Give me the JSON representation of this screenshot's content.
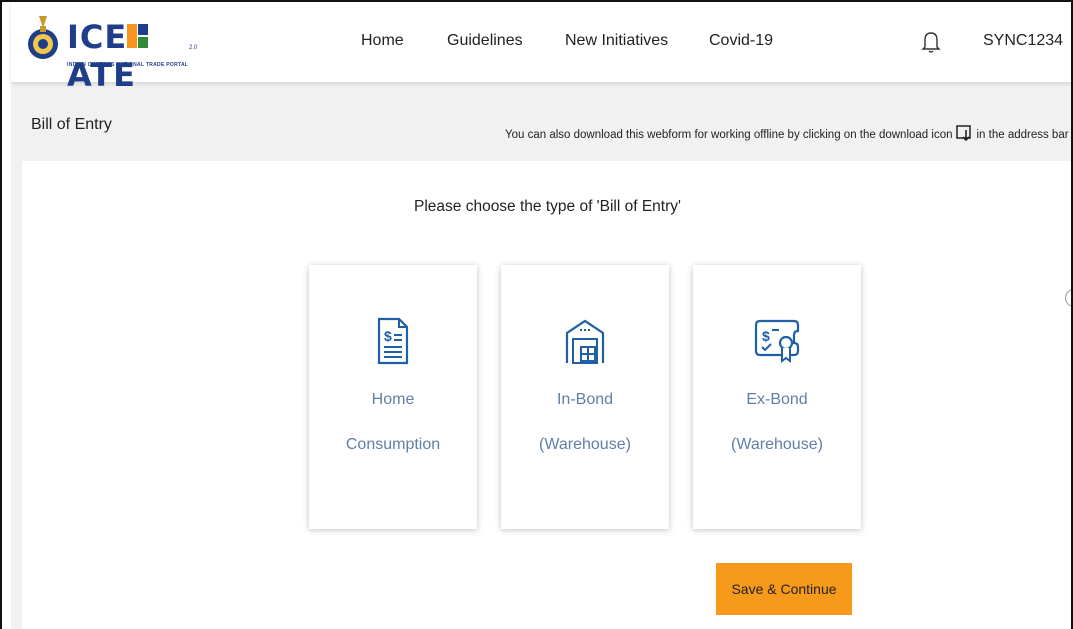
{
  "header": {
    "logo_text_a": "ICE",
    "logo_text_b": "ATE",
    "logo_subtitle": "INDIAN CUSTOMS NATIONAL TRADE PORTAL",
    "logo_version": "2.0",
    "nav": [
      "Home",
      "Guidelines",
      "New Initiatives",
      "Covid-19"
    ],
    "user": "SYNC1234"
  },
  "page": {
    "breadcrumb": "Bill of Entry",
    "note_before": "You can also download this webform for working offline by clicking on the download icon",
    "note_after": "in the address bar",
    "question": "Please choose the type of 'Bill of Entry'",
    "cards": [
      {
        "line1": "Home",
        "line2": "Consumption",
        "icon": "invoice-dollar-icon"
      },
      {
        "line1": "In-Bond",
        "line2": "(Warehouse)",
        "icon": "warehouse-icon"
      },
      {
        "line1": "Ex-Bond",
        "line2": "(Warehouse)",
        "icon": "certificate-icon"
      }
    ],
    "save_label": "Save & Continue"
  },
  "colors": {
    "brand_blue": "#1f3e8a",
    "brand_orange": "#f7941d",
    "button": "#f79a1c",
    "card_text": "#5f7ea8"
  }
}
